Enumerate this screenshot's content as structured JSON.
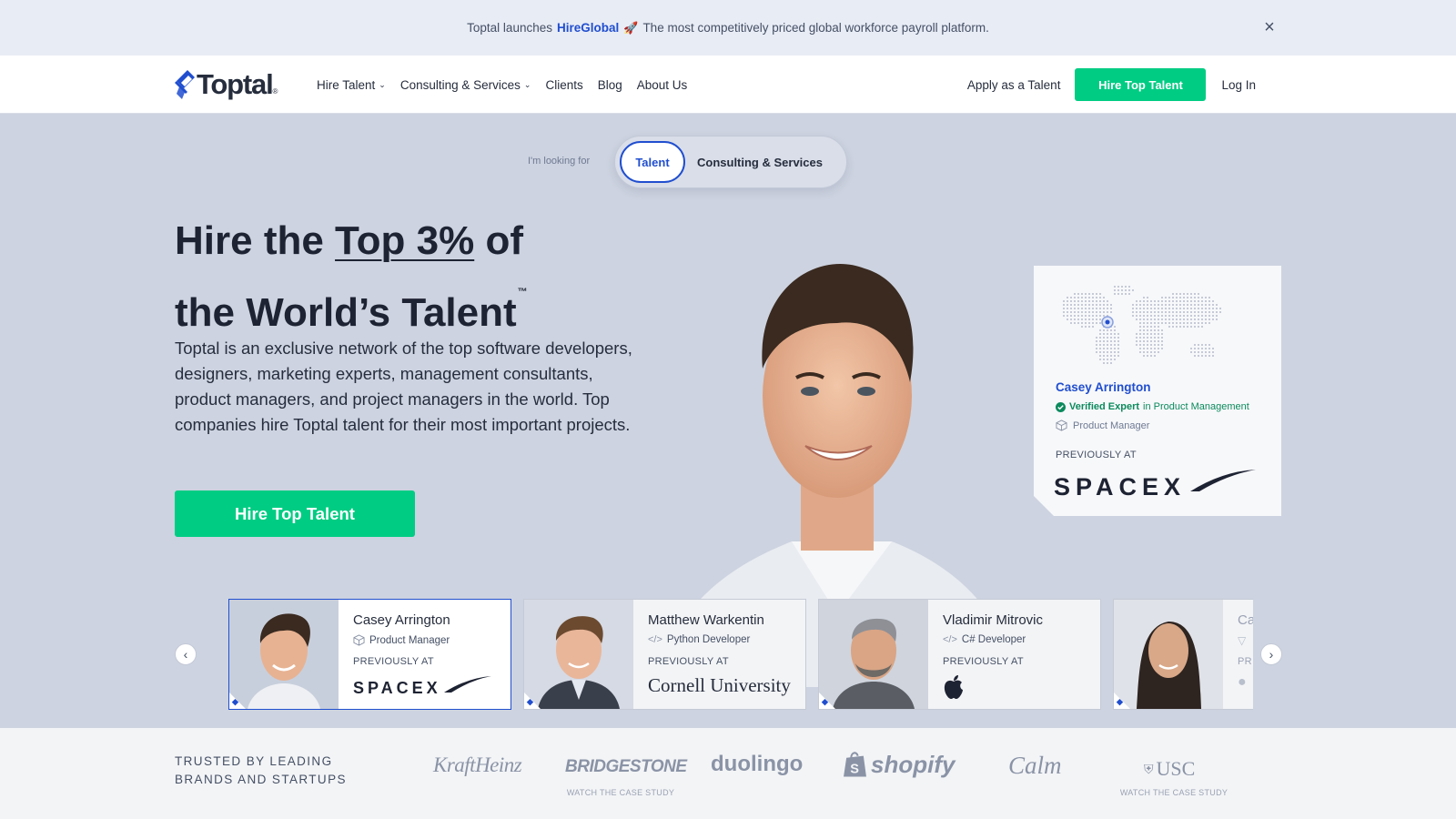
{
  "announcement": {
    "prefix": "Toptal launches",
    "brand": "HireGlobal",
    "rocket_icon": "rocket-icon",
    "text": "The most competitively priced global workforce payroll platform."
  },
  "header": {
    "logo_text": "Toptal",
    "logo_mark": "®",
    "nav": [
      {
        "label": "Hire Talent",
        "dropdown": true
      },
      {
        "label": "Consulting & Services",
        "dropdown": true
      },
      {
        "label": "Clients",
        "dropdown": false
      },
      {
        "label": "Blog",
        "dropdown": false
      },
      {
        "label": "About Us",
        "dropdown": false
      }
    ],
    "apply_label": "Apply as a Talent",
    "hire_label": "Hire Top Talent",
    "login_label": "Log In"
  },
  "hero": {
    "looking_for": "I'm looking for",
    "toggle": {
      "talent": "Talent",
      "consulting": "Consulting & Services",
      "selected": "Talent"
    },
    "headline_pre": "Hire the ",
    "headline_ul": "Top 3%",
    "headline_post": " of",
    "headline_line2": "the World’s Talent",
    "headline_tm": "™",
    "lead": "Toptal is an exclusive network of the top software developers, designers, marketing experts, management consultants, product managers, and project managers in the world. Top companies hire Toptal talent for their most important projects.",
    "cta": "Hire Top Talent"
  },
  "info_card": {
    "name": "Casey Arrington",
    "verified_label": "Verified Expert",
    "verified_in": " in Product Management",
    "role": "Product Manager",
    "previously": "PREVIOUSLY AT",
    "company_logo": "SPACEX"
  },
  "carousel": {
    "prev_icon": "chevron-left-icon",
    "next_icon": "chevron-right-icon",
    "cards": [
      {
        "name": "Casey Arrington",
        "role": "Product Manager",
        "role_icon": "cube-icon",
        "previously": "PREVIOUSLY AT",
        "company": "SPACEX",
        "active": true
      },
      {
        "name": "Matthew Warkentin",
        "role": "Python Developer",
        "role_icon": "code-icon",
        "previously": "PREVIOUSLY AT",
        "company": "Cornell University",
        "active": false
      },
      {
        "name": "Vladimir Mitrovic",
        "role": "C# Developer",
        "role_icon": "code-icon",
        "previously": "PREVIOUSLY AT",
        "company": "Apple",
        "active": false
      },
      {
        "name": "Ca",
        "role": "",
        "role_icon": "filter-icon",
        "previously": "PR",
        "company": "",
        "active": false
      }
    ]
  },
  "trusted": {
    "label": "TRUSTED BY LEADING BRANDS AND STARTUPS",
    "brands": [
      {
        "name": "KraftHeinz",
        "case_study": ""
      },
      {
        "name": "BRIDGESTONE",
        "case_study": "WATCH THE CASE STUDY"
      },
      {
        "name": "duolingo",
        "case_study": ""
      },
      {
        "name": "shopify",
        "case_study": ""
      },
      {
        "name": "Calm",
        "case_study": ""
      },
      {
        "name": "USC",
        "case_study": "WATCH THE CASE STUDY"
      }
    ]
  }
}
